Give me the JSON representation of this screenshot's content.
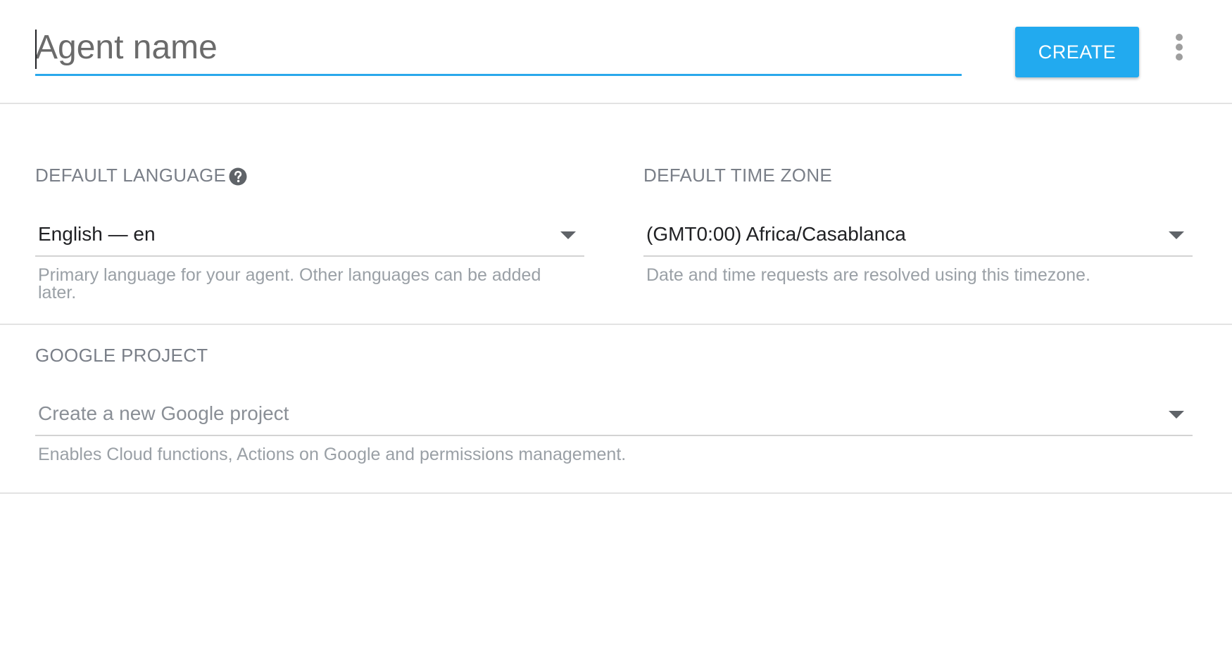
{
  "header": {
    "agent_name_placeholder": "Agent name",
    "agent_name_value": "",
    "create_label": "CREATE",
    "more_icon": "more-vertical-icon"
  },
  "language": {
    "label": "DEFAULT LANGUAGE",
    "help_icon": "help-circle-icon",
    "value": "English — en",
    "hint": "Primary language for your agent. Other languages can be added later."
  },
  "timezone": {
    "label": "DEFAULT TIME ZONE",
    "value": "(GMT0:00) Africa/Casablanca",
    "hint": "Date and time requests are resolved using this timezone."
  },
  "project": {
    "label": "GOOGLE PROJECT",
    "placeholder": "Create a new Google project",
    "hint": "Enables Cloud functions, Actions on Google and permissions management."
  },
  "colors": {
    "accent": "#22aaef",
    "underline_active": "#2aa8ec",
    "label": "#7a7f88",
    "hint": "#9aa0a6",
    "divider": "#e3e3e3"
  }
}
